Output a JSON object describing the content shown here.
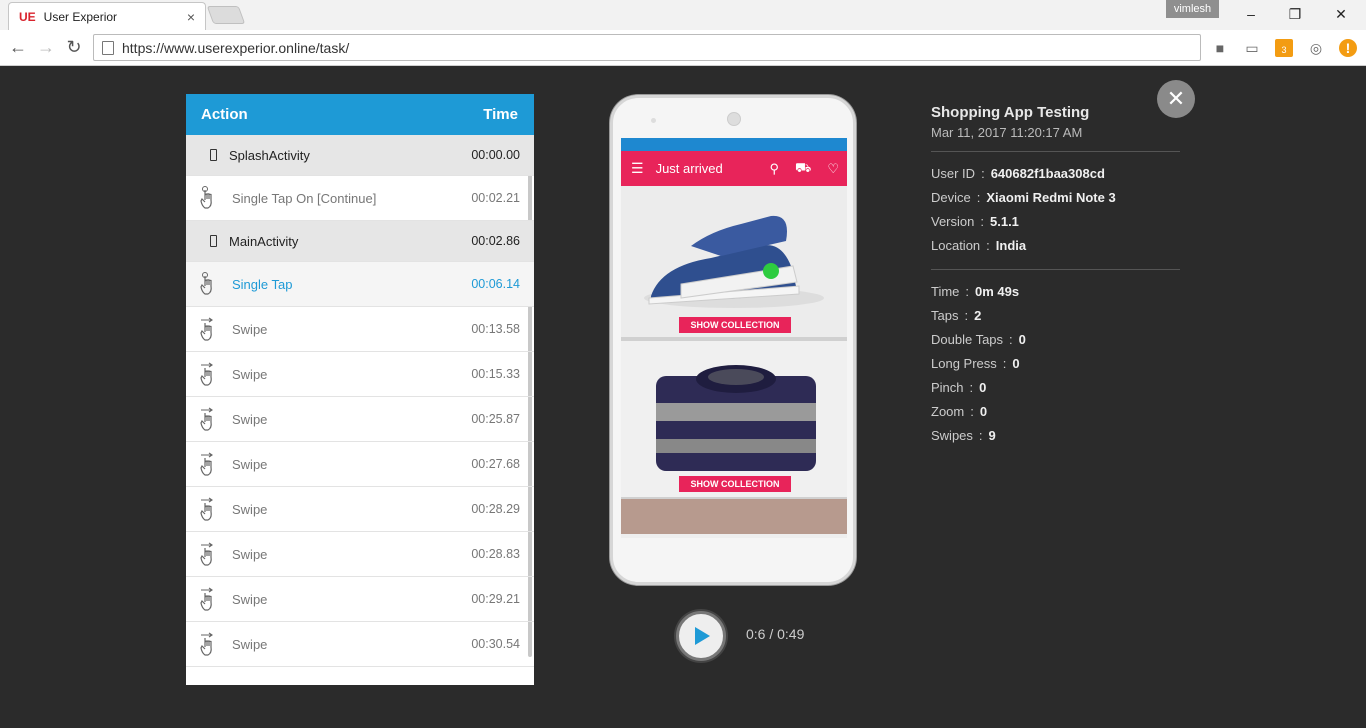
{
  "browser": {
    "tab_title": "User Experior",
    "tab_favicon": "UE",
    "tab_close": "×",
    "user": "vimlesh",
    "url": "https://www.userexperior.online/task/",
    "ext_badge": "3"
  },
  "panel": {
    "header_action": "Action",
    "header_time": "Time",
    "rows": [
      {
        "kind": "activity",
        "label": "SplashActivity",
        "time": "00:00.00"
      },
      {
        "kind": "event",
        "label": "Single Tap On [Continue]",
        "time": "00:02.21",
        "icon": "tap-icon"
      },
      {
        "kind": "activity",
        "label": "MainActivity",
        "time": "00:02.86"
      },
      {
        "kind": "event",
        "label": "Single Tap",
        "time": "00:06.14",
        "icon": "tap-icon",
        "highlight": true
      },
      {
        "kind": "event",
        "label": "Swipe",
        "time": "00:13.58",
        "icon": "swipe-icon"
      },
      {
        "kind": "event",
        "label": "Swipe",
        "time": "00:15.33",
        "icon": "swipe-icon"
      },
      {
        "kind": "event",
        "label": "Swipe",
        "time": "00:25.87",
        "icon": "swipe-icon"
      },
      {
        "kind": "event",
        "label": "Swipe",
        "time": "00:27.68",
        "icon": "swipe-icon"
      },
      {
        "kind": "event",
        "label": "Swipe",
        "time": "00:28.29",
        "icon": "swipe-icon"
      },
      {
        "kind": "event",
        "label": "Swipe",
        "time": "00:28.83",
        "icon": "swipe-icon"
      },
      {
        "kind": "event",
        "label": "Swipe",
        "time": "00:29.21",
        "icon": "swipe-icon"
      },
      {
        "kind": "event",
        "label": "Swipe",
        "time": "00:30.54",
        "icon": "swipe-icon"
      }
    ]
  },
  "phone": {
    "app_title": "Just arrived",
    "show_collection_1": "SHOW COLLECTION",
    "show_collection_2": "SHOW COLLECTION"
  },
  "player": {
    "time": "0:6 / 0:49"
  },
  "info": {
    "title": "Shopping App Testing",
    "date": "Mar 11, 2017 11:20:17 AM",
    "details": [
      {
        "key": "User ID",
        "value": "640682f1baa308cd"
      },
      {
        "key": "Device",
        "value": "Xiaomi Redmi Note 3"
      },
      {
        "key": "Version",
        "value": "5.1.1"
      },
      {
        "key": "Location",
        "value": "India"
      }
    ],
    "stats": [
      {
        "key": "Time",
        "value": "0m 49s"
      },
      {
        "key": "Taps",
        "value": "2"
      },
      {
        "key": "Double Taps",
        "value": "0"
      },
      {
        "key": "Long Press",
        "value": "0"
      },
      {
        "key": "Pinch",
        "value": "0"
      },
      {
        "key": "Zoom",
        "value": "0"
      },
      {
        "key": "Swipes",
        "value": "9"
      }
    ]
  },
  "colors": {
    "accent": "#1e9ad6",
    "app_bar": "#e8245a",
    "background": "#2b2b2b"
  }
}
